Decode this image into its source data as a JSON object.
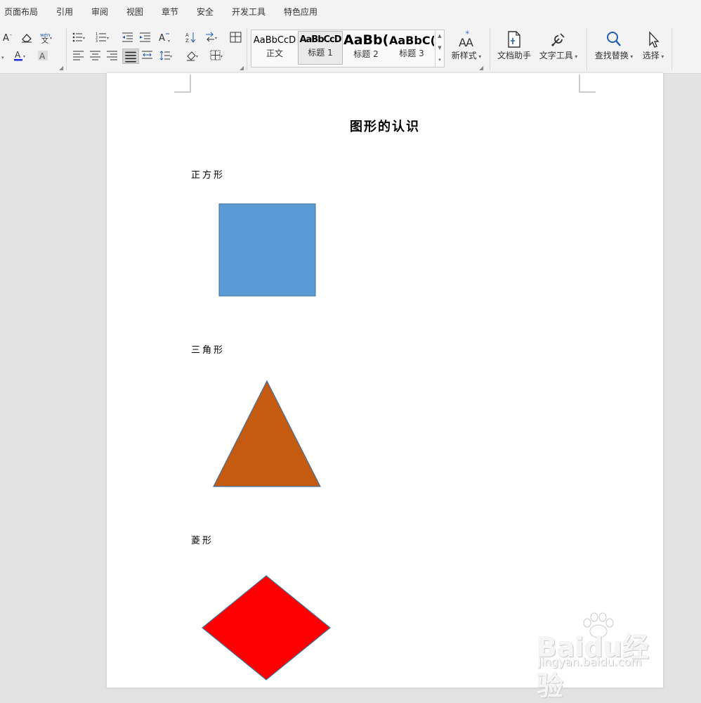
{
  "menu": [
    "页面布局",
    "引用",
    "审阅",
    "视图",
    "章节",
    "安全",
    "开发工具",
    "特色应用"
  ],
  "styles": [
    {
      "preview": "AaBbCcD",
      "label": "正文"
    },
    {
      "preview": "AaBbCcD",
      "label": "标题 1"
    },
    {
      "preview": "AaBb(",
      "label": "标题 2"
    },
    {
      "preview": "AaBbC(",
      "label": "标题 3"
    }
  ],
  "buttons": {
    "new_style": "新样式",
    "doc_helper": "文档助手",
    "text_tools": "文字工具",
    "find_replace": "查找替换",
    "select": "选择"
  },
  "document": {
    "title": "图形的认识",
    "sections": [
      {
        "label": "正方形",
        "shape": "square",
        "fill": "#5b9bd5"
      },
      {
        "label": "三角形",
        "shape": "triangle",
        "fill": "#c55a11"
      },
      {
        "label": "菱形",
        "shape": "rhombus",
        "fill": "#ff0000"
      }
    ]
  },
  "watermark": {
    "brand": "Baidu经验",
    "url": "jingyan.baidu.com"
  }
}
